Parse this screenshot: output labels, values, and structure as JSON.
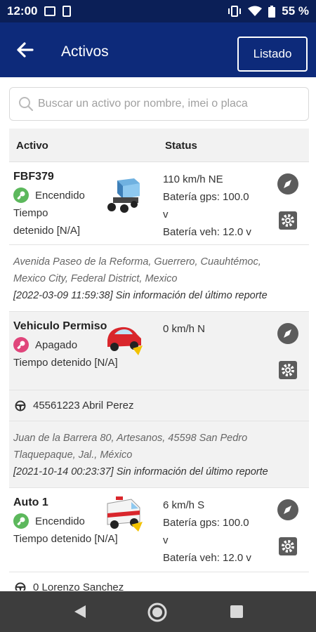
{
  "statusbar": {
    "time": "12:00",
    "battery": "55 %",
    "icons": [
      "image-icon",
      "clipboard-icon",
      "vibrate-icon",
      "wifi-icon",
      "battery-icon"
    ]
  },
  "header": {
    "title": "Activos",
    "listado_label": "Listado",
    "back_icon": "arrow-left-icon",
    "color": "#0d2a7a"
  },
  "search": {
    "placeholder": "Buscar un activo por nombre, imei o placa",
    "value": ""
  },
  "table": {
    "col_activo": "Activo",
    "col_status": "Status"
  },
  "assets": [
    {
      "name": "FBF379",
      "ignition": "Encendido",
      "ignition_color": "#5cb85c",
      "stopped_line1": "Tiempo",
      "stopped_line2": "detenido [N/A]",
      "icon": "truck-icon",
      "speed": "110 km/h NE",
      "gps_line1": "Batería gps: 100.0",
      "gps_line2": "v",
      "veh_battery": "Batería veh: 12.0 v",
      "address_line1": "Avenida Paseo de la Reforma, Guerrero, Cuauhtémoc,",
      "address_line2": "Mexico City, Federal District, Mexico",
      "report": "[2022-03-09 11:59:38] Sin información del último reporte"
    },
    {
      "name": "Vehiculo Permiso",
      "ignition": "Apagado",
      "ignition_color": "#e0457b",
      "stopped": "Tiempo detenido [N/A]",
      "icon": "red-car-icon",
      "speed": "0 km/h N",
      "driver": "45561223 Abril Perez",
      "address_line1": "Juan de la Barrera 80, Artesanos, 45598 San Pedro",
      "address_line2": "Tlaquepaque, Jal., México",
      "report": "[2021-10-14 00:23:37] Sin información del último reporte"
    },
    {
      "name": "Auto 1",
      "ignition": "Encendido",
      "ignition_color": "#5cb85c",
      "stopped": "Tiempo detenido [N/A]",
      "icon": "ambulance-icon",
      "speed": "6 km/h S",
      "gps_line1": "Batería gps: 100.0",
      "gps_line2": "v",
      "veh_battery": "Batería veh: 12.0 v",
      "driver": "0 Lorenzo Sanchez"
    }
  ]
}
